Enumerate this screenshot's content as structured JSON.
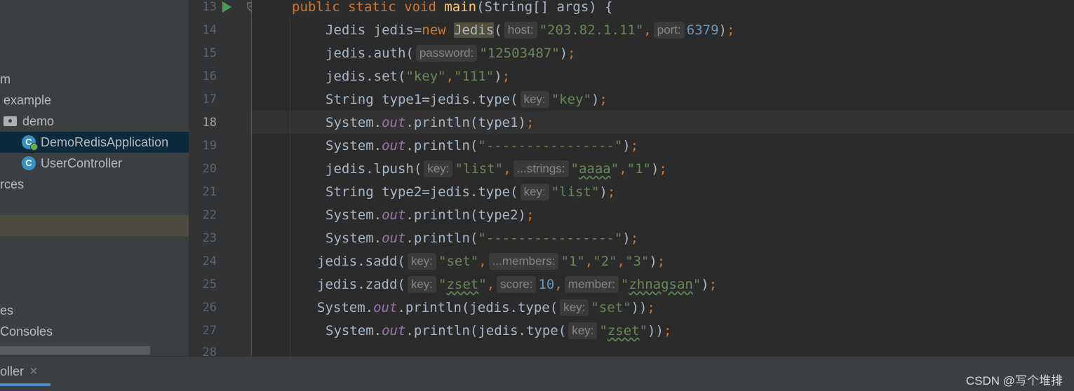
{
  "project_tree": {
    "items": [
      {
        "label": "m"
      },
      {
        "label": "example"
      },
      {
        "label": "demo"
      },
      {
        "label": "DemoRedisApplication"
      },
      {
        "label": "UserController"
      },
      {
        "label": "rces"
      },
      {
        "label": "es"
      },
      {
        "label": "Consoles"
      }
    ],
    "class_icon_letter": "C"
  },
  "editor": {
    "line_numbers": [
      "13",
      "14",
      "15",
      "16",
      "17",
      "18",
      "19",
      "20",
      "21",
      "22",
      "23",
      "24",
      "25",
      "26",
      "27",
      "28"
    ],
    "current_line": "18",
    "hints": {
      "host": "host:",
      "port": "port:",
      "password": "password:",
      "key": "key:",
      "strings": "...strings:",
      "members": "...members:",
      "score": "score:",
      "member": "member:"
    }
  },
  "bottom_bar": {
    "active_tab": "oller",
    "close_glyph": "×",
    "watermark": "CSDN @写个堆排"
  },
  "colors": {
    "keyword": "#cc7832",
    "method": "#ffc66d",
    "string": "#6a8759",
    "number": "#6897bb",
    "static_field": "#9876aa",
    "text": "#a9b7c6",
    "selection": "#0d293e",
    "tab_underline": "#4a88c7"
  },
  "icons": [
    "run-icon",
    "fold-icon",
    "folder-icon",
    "class-icon",
    "close-icon"
  ]
}
